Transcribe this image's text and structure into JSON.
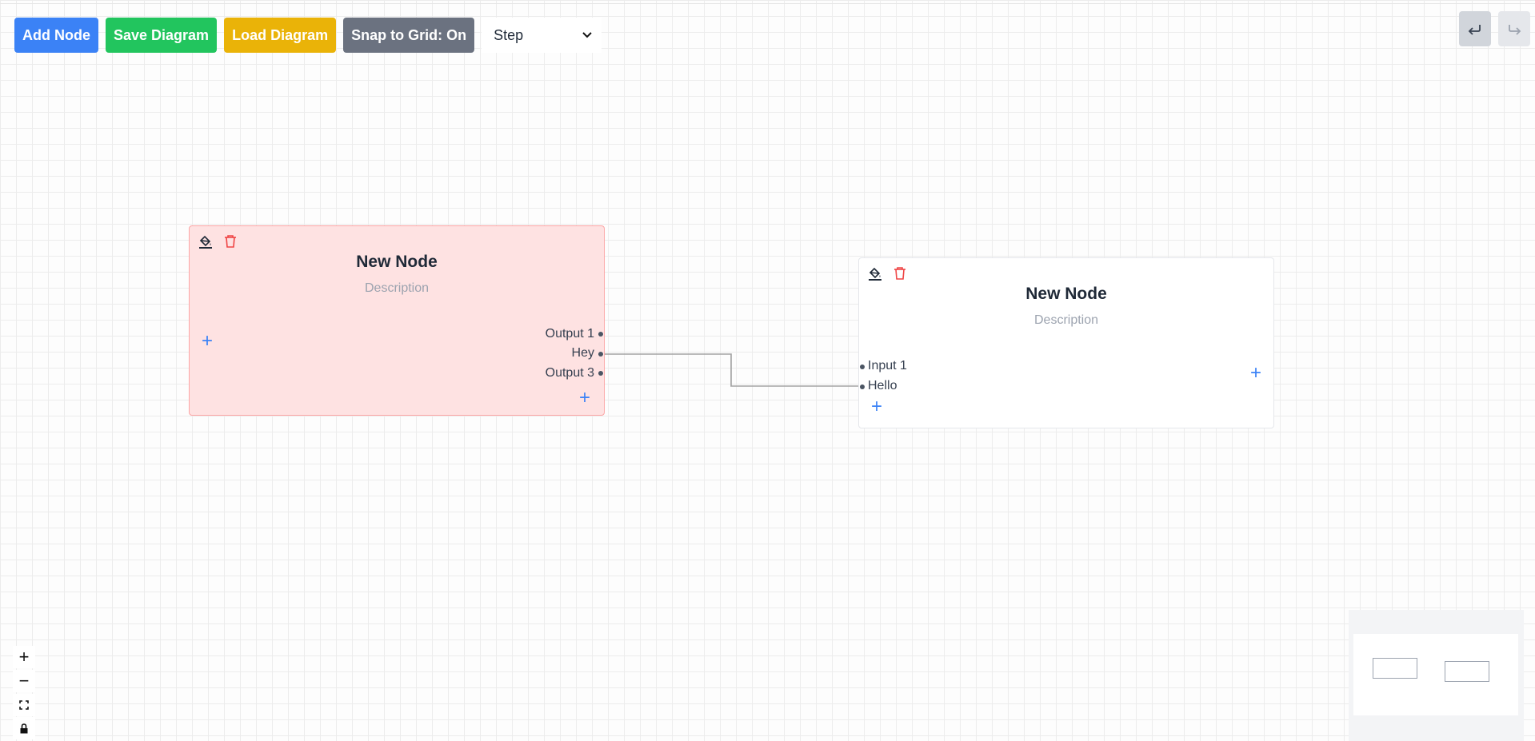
{
  "toolbar": {
    "add_node": "Add Node",
    "save_diagram": "Save Diagram",
    "load_diagram": "Load Diagram",
    "snap_to_grid": "Snap to Grid: On",
    "edge_type": "Step"
  },
  "colors": {
    "add_node": "#3b82f6",
    "save_diagram": "#22c55e",
    "load_diagram": "#eab308",
    "snap_to_grid": "#6b7280",
    "node1_background": "#fee2e2",
    "node2_background": "#ffffff",
    "delete_icon": "#ef4444",
    "add_port": "#3b82f6"
  },
  "history": {
    "undo_icon": "undo-icon",
    "redo_icon": "redo-icon"
  },
  "nodes": [
    {
      "title": "New Node",
      "description": "Description",
      "inputs": [],
      "outputs": [
        "Output 1",
        "Hey",
        "Output 3"
      ]
    },
    {
      "title": "New Node",
      "description": "Description",
      "inputs": [
        "Input 1",
        "Hello"
      ],
      "outputs": []
    }
  ],
  "edges": [
    {
      "from": "Hey",
      "to": "Hello",
      "type": "Step"
    }
  ],
  "controls": {
    "zoom_in": "+",
    "zoom_out": "−",
    "fit_view_icon": "fit-view-icon",
    "lock_icon": "lock-icon"
  }
}
